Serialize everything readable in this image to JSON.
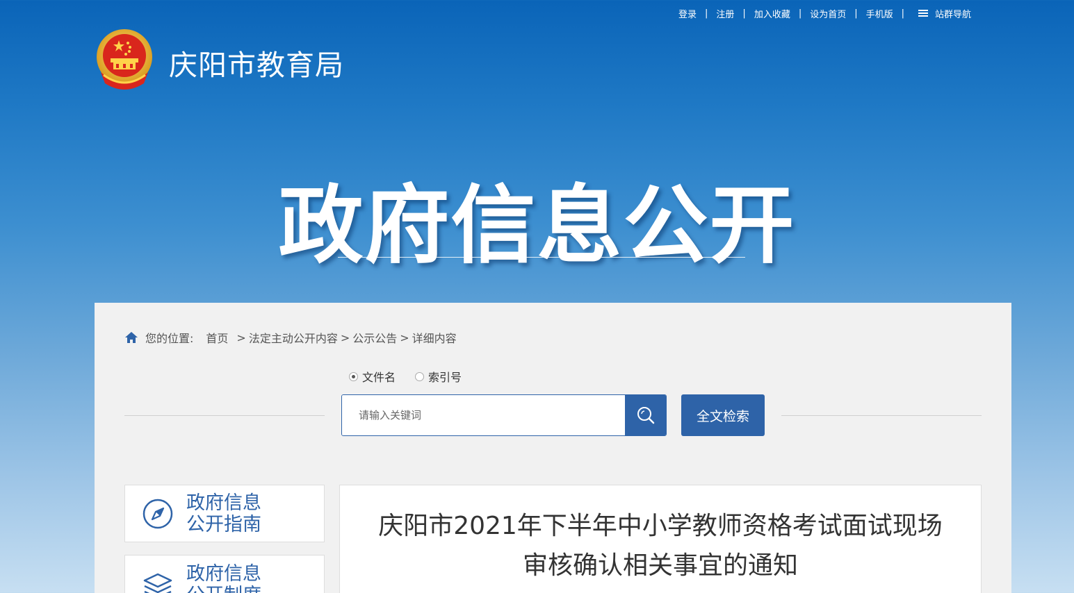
{
  "toplinks": {
    "login": "登录",
    "register": "注册",
    "favorite": "加入收藏",
    "homepage": "设为首页",
    "mobile": "手机版",
    "sitenav": "站群导航",
    "separator": "|"
  },
  "site": {
    "title": "庆阳市教育局"
  },
  "banner": {
    "title": "政府信息公开"
  },
  "breadcrumb": {
    "prefix": "您的位置:",
    "items": [
      "首页",
      "法定主动公开内容",
      "公示公告",
      "详细内容"
    ],
    "arrow": ">"
  },
  "search": {
    "options": [
      "文件名",
      "索引号"
    ],
    "selected": "文件名",
    "placeholder": "请输入关键词",
    "value": "",
    "fulltext_label": "全文检索"
  },
  "sidebar": {
    "items": [
      {
        "label": "政府信息公开指南",
        "icon": "compass-icon"
      },
      {
        "label": "政府信息公开制度",
        "icon": "layers-icon"
      }
    ]
  },
  "article": {
    "title": "庆阳市2021年下半年中小学教师资格考试面试现场审核确认相关事宜的通知"
  },
  "colors": {
    "primary": "#2e63a8",
    "panel": "#f1f1f1"
  }
}
